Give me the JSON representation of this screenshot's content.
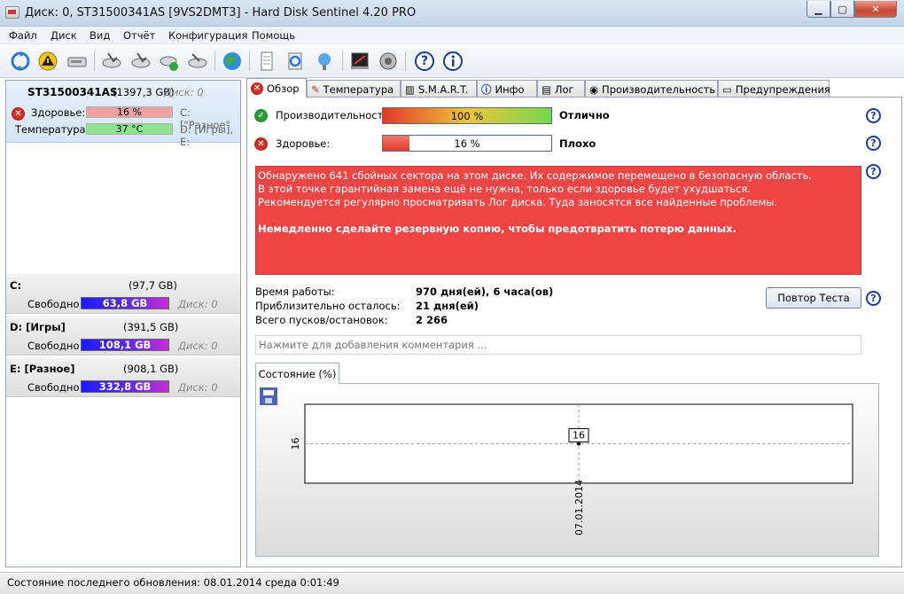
{
  "window": {
    "title": "Диск: 0, ST31500341AS [9VS2DMT3]  -  Hard Disk Sentinel 4.20 PRO",
    "min": "0",
    "max": "1",
    "close": "r"
  },
  "menu": [
    "Файл",
    "Диск",
    "Вид",
    "Отчёт",
    "Конфигурация",
    "Помощь"
  ],
  "toolbar": [
    "refresh-icon",
    "warning-icon",
    "drive-icon",
    "disk-check-icon",
    "disk-test-icon",
    "disk-ok-icon",
    "disk-settings-icon",
    "globe-icon",
    "report-icon",
    "update-icon",
    "network-icon",
    "log-icon",
    "sound-icon",
    "help-icon",
    "info-icon"
  ],
  "disk": {
    "model": "ST31500341AS",
    "size": "(1397,3 GB)",
    "index": "Диск: 0",
    "health_label": "Здоровье:",
    "health_value": "16 %",
    "health_pct": 16,
    "temp_label": "Температура:",
    "temp_value": "37 °C",
    "temp_pct": 100,
    "drive1": "C: [\"Разное\"",
    "drive2": "D: [Игры], E:"
  },
  "partitions": [
    {
      "name": "C:",
      "size": "(97,7 GB)",
      "free_label": "Свободно",
      "free": "63,8 GB",
      "disk": "Диск: 0"
    },
    {
      "name": "D: [Игры]",
      "size": "(391,5 GB)",
      "free_label": "Свободно",
      "free": "108,1 GB",
      "disk": "Диск: 0"
    },
    {
      "name": "E: [Разное]",
      "size": "(908,1 GB)",
      "free_label": "Свободно",
      "free": "332,8 GB",
      "disk": "Диск: 0"
    }
  ],
  "tabs": [
    "Обзор",
    "Температура",
    "S.M.A.R.T.",
    "Инфо",
    "Лог",
    "Производительность",
    "Предупреждения"
  ],
  "overview": {
    "perf_label": "Производительность:",
    "perf_value": "100 %",
    "perf_pct": 100,
    "perf_status": "Отлично",
    "health_label": "Здоровье:",
    "health_value": "16 %",
    "health_pct": 16,
    "health_status": "Плохо",
    "msg1": "Обнаружено 641 сбойных сектора на этом диске. Их содержимое перемещено в безопасную область.",
    "msg2": "В этой точке гарантийная замена ещё не нужна, только если здоровье будет ухудшаться.",
    "msg3": "Рекомендуется регулярно просматривать Лог диска. Туда заносятся все найденные проблемы.",
    "msg4": "Немедленно сделайте резервную копию, чтобы предотвратить потерю данных.",
    "uptime_label": "Время работы:",
    "uptime": "970 дня(ей), 6 часа(ов)",
    "remain_label": "Приблизительно осталось:",
    "remain": "21 дня(ей)",
    "starts_label": "Всего пусков/остановок:",
    "starts": "2 266",
    "retest": "Повтор Теста",
    "comment_placeholder": "Нажмите для добавления комментария ...",
    "chart_tab": "Состояние (%)"
  },
  "chart_data": {
    "type": "line",
    "x": [
      "07.01.2014"
    ],
    "values": [
      16
    ],
    "ytick": "16",
    "data_label": "16"
  },
  "statusbar": "Состояние последнего обновления: 08.01.2014 среда 0:01:49"
}
